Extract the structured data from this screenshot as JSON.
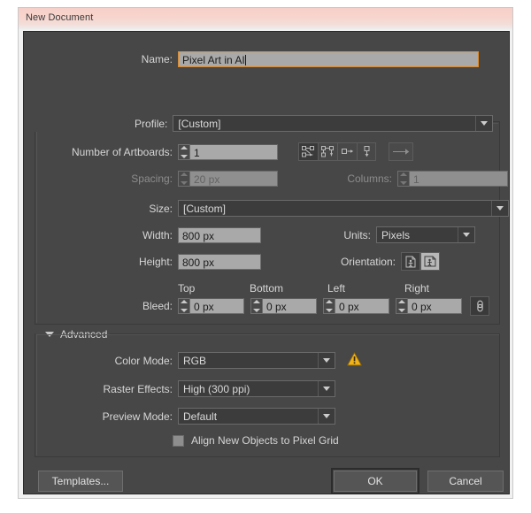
{
  "window": {
    "title": "New Document"
  },
  "fields": {
    "name": {
      "label": "Name:",
      "value": "Pixel Art in AI"
    },
    "profile": {
      "label": "Profile:",
      "value": "[Custom]"
    },
    "artboards": {
      "label": "Number of Artboards:",
      "value": "1",
      "arrange_icons": [
        "grid-by-row-icon",
        "grid-by-column-icon",
        "arrange-by-row-icon",
        "arrange-by-column-icon"
      ],
      "direction_icon": "right-to-left-layout-icon"
    },
    "spacing": {
      "label": "Spacing:",
      "value": "20 px",
      "disabled": true
    },
    "columns": {
      "label": "Columns:",
      "value": "1",
      "disabled": true
    },
    "size": {
      "label": "Size:",
      "value": "[Custom]"
    },
    "width": {
      "label": "Width:",
      "value": "800 px"
    },
    "height": {
      "label": "Height:",
      "value": "800 px"
    },
    "units": {
      "label": "Units:",
      "value": "Pixels"
    },
    "orientation": {
      "label": "Orientation:",
      "portrait_icon": "portrait-orientation-icon",
      "landscape_icon": "landscape-orientation-icon",
      "selected": "landscape"
    },
    "bleed": {
      "label": "Bleed:",
      "headers": {
        "top": "Top",
        "bottom": "Bottom",
        "left": "Left",
        "right": "Right"
      },
      "top": "0 px",
      "bottom": "0 px",
      "left": "0 px",
      "right": "0 px",
      "link_icon": "chain-link-icon"
    }
  },
  "advanced": {
    "label": "Advanced",
    "disclosure_icon": "triangle-down-icon",
    "color_mode": {
      "label": "Color Mode:",
      "value": "RGB",
      "warning_icon": "warning-triangle-icon"
    },
    "raster_effects": {
      "label": "Raster Effects:",
      "value": "High (300 ppi)"
    },
    "preview_mode": {
      "label": "Preview Mode:",
      "value": "Default"
    },
    "align_pixel_grid": {
      "label": "Align New Objects to Pixel Grid",
      "checked": false
    }
  },
  "buttons": {
    "templates": "Templates...",
    "ok": "OK",
    "cancel": "Cancel"
  },
  "colors": {
    "dialog_bg": "#474747",
    "titlebar_accent": "#f6cfc8",
    "focus_border": "#e08b2a",
    "warning": "#f2b31a",
    "field_bg": "#a9a9a9"
  }
}
